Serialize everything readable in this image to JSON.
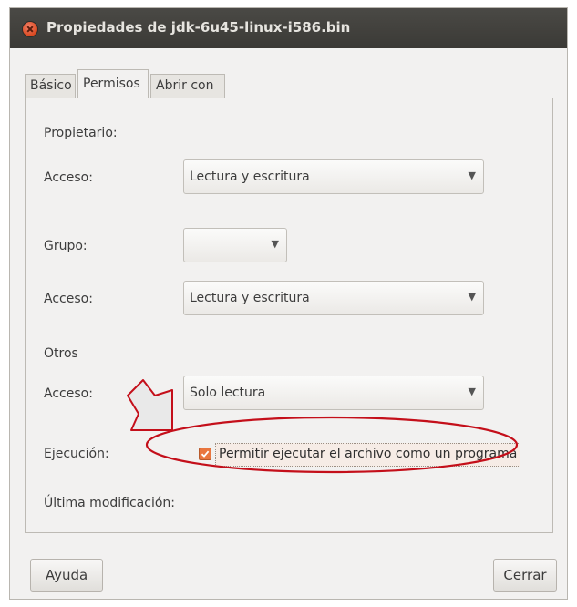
{
  "window": {
    "title": "Propiedades de jdk-6u45-linux-i586.bin"
  },
  "tabs": [
    {
      "label": "Básico",
      "active": false
    },
    {
      "label": "Permisos",
      "active": true
    },
    {
      "label": "Abrir con",
      "active": false
    }
  ],
  "permissions": {
    "owner_heading": "Propietario:",
    "owner_access_label": "Acceso:",
    "owner_access_value": "Lectura y escritura",
    "group_label": "Grupo:",
    "group_value": "",
    "group_access_label": "Acceso:",
    "group_access_value": "Lectura y escritura",
    "others_heading": "Otros",
    "others_access_label": "Acceso:",
    "others_access_value": "Solo lectura",
    "execution_label": "Ejecución:",
    "execution_checkbox_label": "Permitir ejecutar el archivo como un programa",
    "execution_checked": true,
    "last_modified_label": "Última modificación:"
  },
  "buttons": {
    "help": "Ayuda",
    "close": "Cerrar"
  },
  "icons": {
    "close": "close-icon",
    "dropdown": "chevron-down-icon",
    "check": "check-icon",
    "annotation_arrow": "arrow-icon"
  },
  "colors": {
    "titlebar": "#3c3b37",
    "close_button": "#e2552c",
    "checkbox": "#e9763f",
    "annotation": "#c40f1a"
  }
}
